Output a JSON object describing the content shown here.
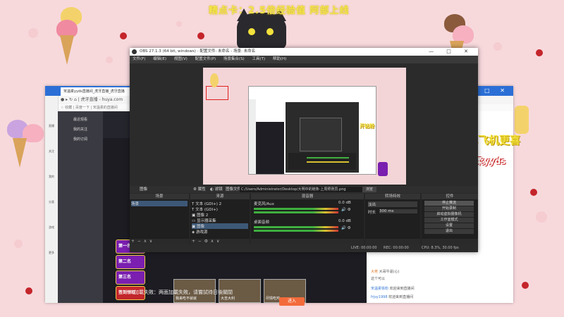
{
  "overlay": {
    "title": "精点卡：2.5倍经验值 阿部上线",
    "promo": "开钻粉比飞机更喜",
    "weibo": "宋温柔yyds"
  },
  "browser": {
    "tab_title": "宋温柔yyds直播间_虎牙直播_虎牙直播",
    "nav_text": "● ▸  ↻  ⌂  |  虎牙直播 - huya.com",
    "bookmarks": "☆ 收藏  |  百度一下  |  宋温柔的直播间",
    "window_controls": "—  □  ✕",
    "side_items": [
      "直播",
      "关注",
      "我的",
      "分类",
      "游戏",
      "更多"
    ],
    "left_side": [
      "最近观看",
      "我的关注",
      "我的订阅"
    ],
    "thumbs": [
      "我来吃不就就",
      "大吉大利",
      "尽情吃鸡"
    ],
    "caption": "加載失敗：两面加載失敗，请嘗試待日後關閉",
    "join_btn": "进入",
    "cards": [
      "第一名",
      "第二名",
      "第三名",
      "签到领取"
    ],
    "chat": [
      {
        "user": "大佬",
        "text": "大哥牛逼(心)"
      },
      {
        "user": "",
        "text": "这个可以"
      },
      {
        "user": "宋温柔铁粉",
        "text": "欢迎来到直播间"
      },
      {
        "user": "frjsy1998",
        "text": "欢迎来到直播间"
      }
    ]
  },
  "obs": {
    "title": "OBS 27.1.3 (64 bit, windows) - 配置文件: 未命名 - 场景: 未命名",
    "window_controls": "—  □  ✕",
    "menu": [
      "文件(F)",
      "编辑(E)",
      "视图(V)",
      "配置文件(P)",
      "场景集合(S)",
      "工具(T)",
      "帮助(H)"
    ],
    "preview_text": "开钻粉",
    "source_toolbar": {
      "image_label": "图像",
      "properties": "属性",
      "filters": "滤镜",
      "image_file": "图像文件",
      "path": "C:/Users/Administrator/Desktop/大明中的链条-上周照例员.png",
      "browse": "浏览"
    },
    "docks": {
      "scenes_header": "场景",
      "sources_header": "来源",
      "mixer_header": "混音器",
      "transitions_header": "转场特效",
      "controls_header": "控件",
      "scenes": [
        "场景"
      ],
      "sources": [
        "文本 (GDI+) 2",
        "文本 (GDI+)",
        "图像 2",
        "显示器采集",
        "图像",
        "游戏源"
      ],
      "mixer": [
        {
          "name": "桌面音频",
          "db": "0.0 dB"
        },
        {
          "name": "麦克风/Aux",
          "db": "0.0 dB"
        }
      ],
      "transition_type": "淡出",
      "duration_label": "时长",
      "duration_value": "300 ms",
      "controls": [
        "停止推流",
        "开始录制",
        "启动虚拟摄像机",
        "工作室模式",
        "设置",
        "退出"
      ]
    },
    "status": {
      "live": "LIVE: 00:00:00",
      "rec": "REC: 00:00:00",
      "cpu": "CPU: 8.3%, 30.00 fps"
    }
  }
}
